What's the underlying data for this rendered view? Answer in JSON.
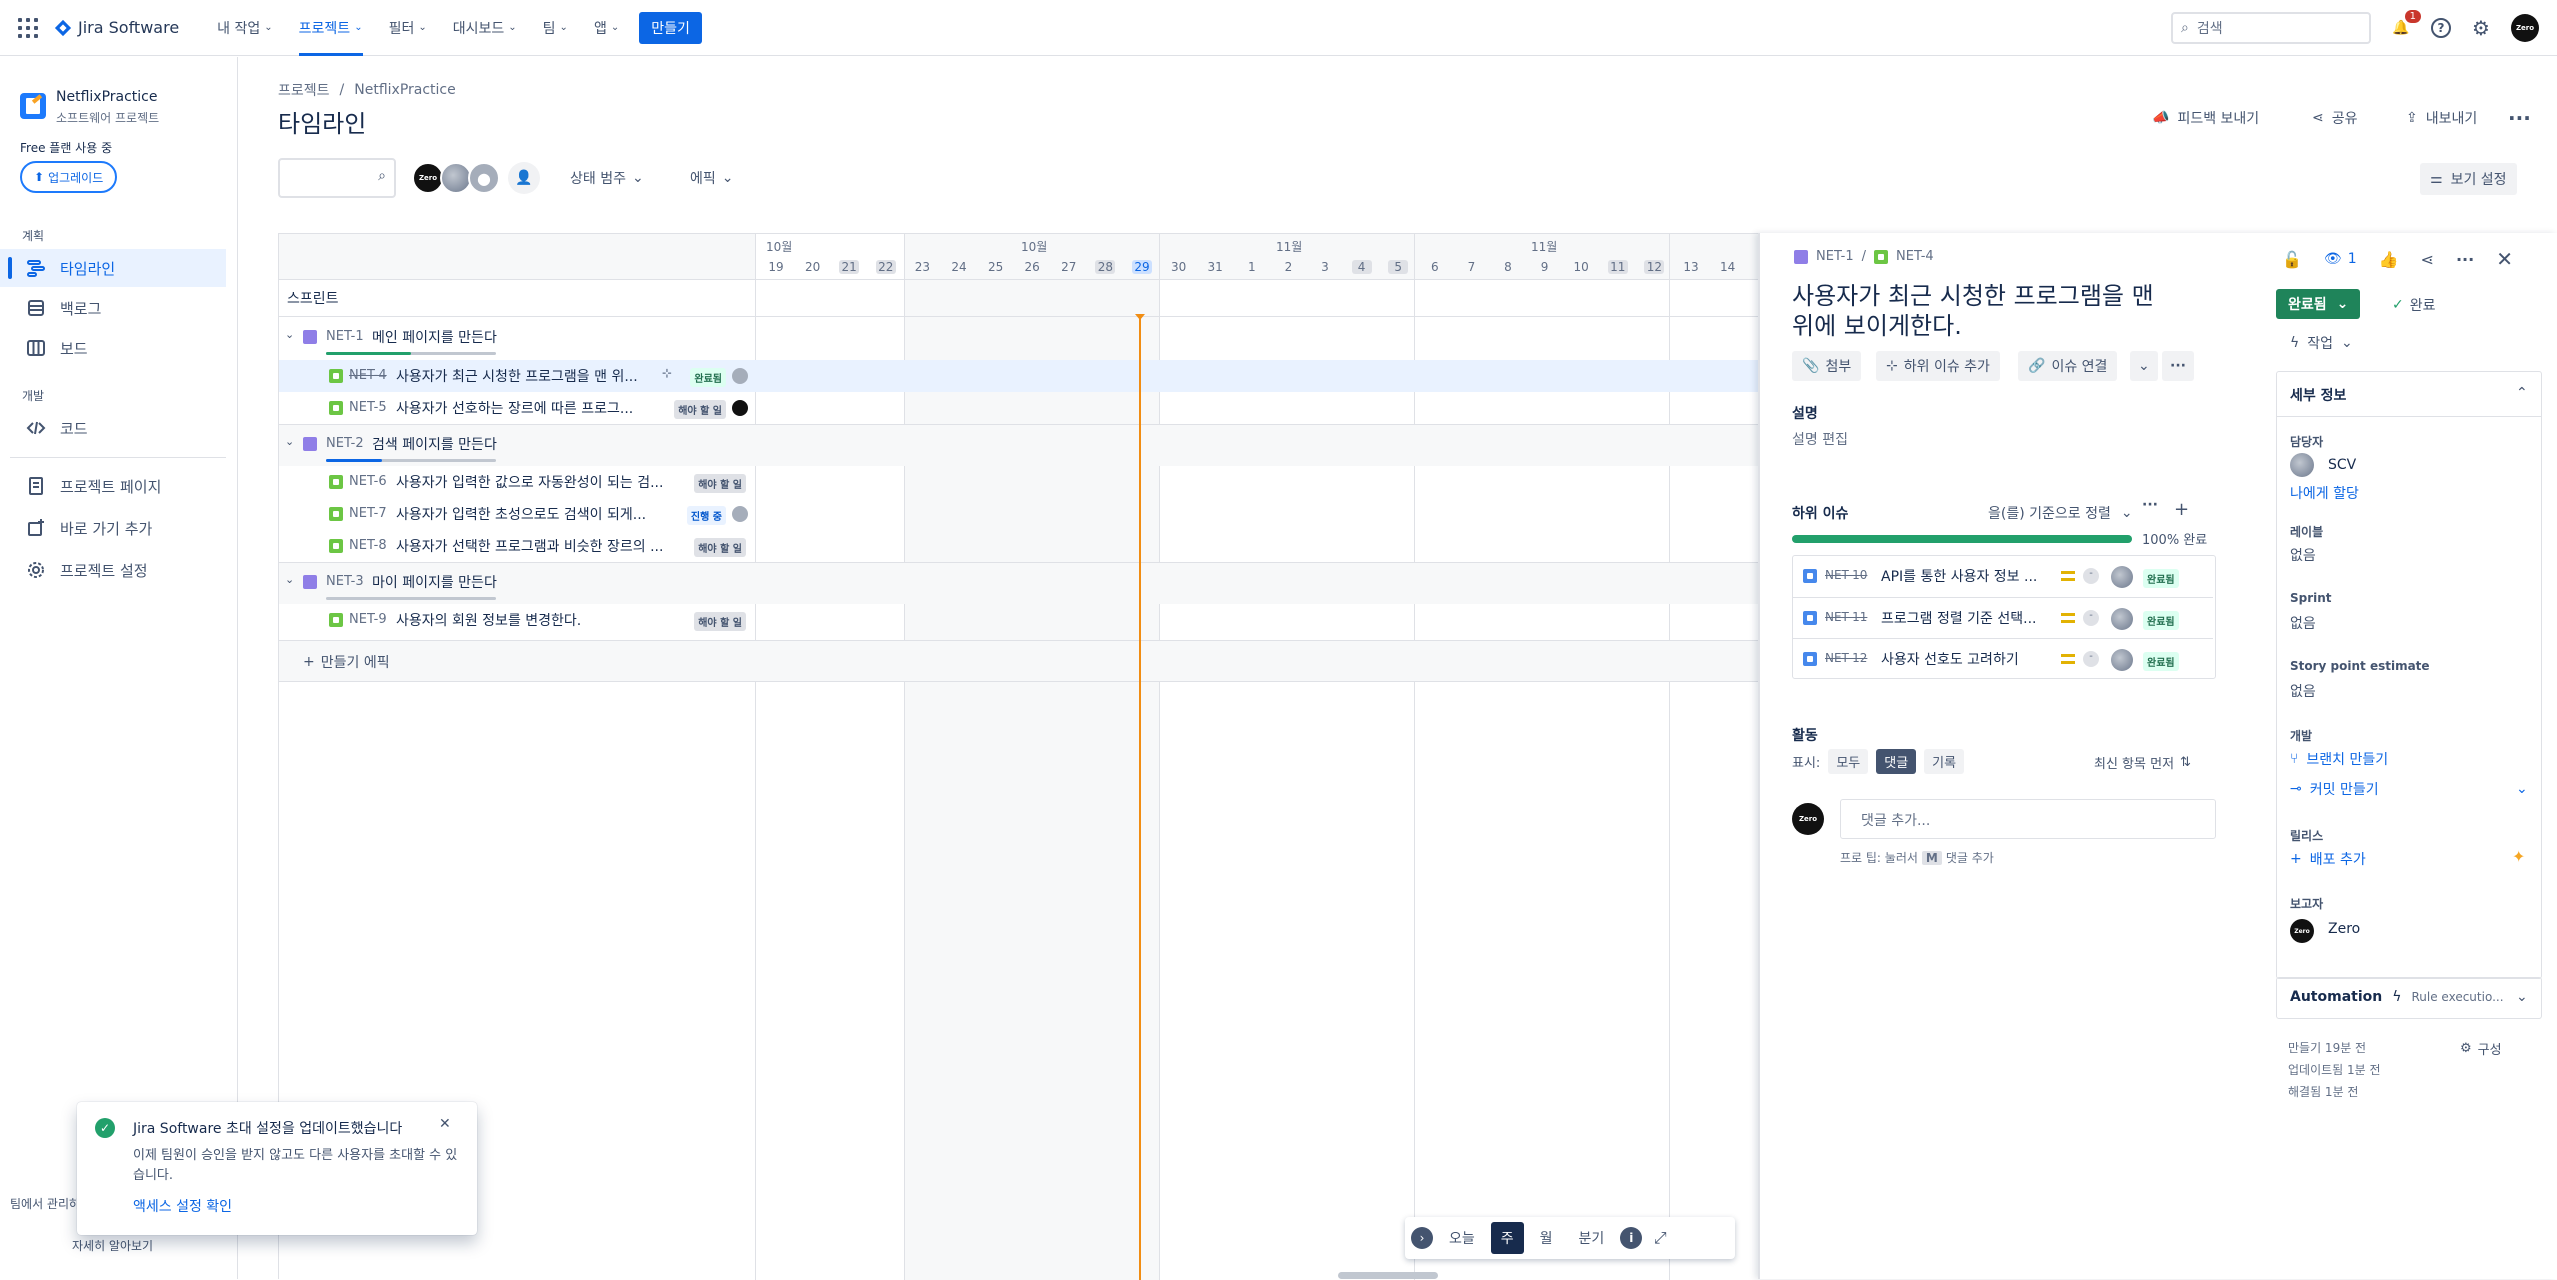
{
  "nav": {
    "product": "Jira Software",
    "items": [
      {
        "label": "내 작업"
      },
      {
        "label": "프로젝트"
      },
      {
        "label": "필터"
      },
      {
        "label": "대시보드"
      },
      {
        "label": "팀"
      },
      {
        "label": "앱"
      }
    ],
    "create": "만들기",
    "search_placeholder": "검색",
    "notif_count": "1",
    "avatar": "Zero"
  },
  "sidebar": {
    "project_name": "NetflixPractice",
    "project_type": "소프트웨어 프로젝트",
    "plan": "Free 플랜 사용 중",
    "upgrade": "업그레이드",
    "section_plan": "계획",
    "section_dev": "개발",
    "items": [
      "타임라인",
      "백로그",
      "보드",
      "코드",
      "프로젝트 페이지",
      "바로 가기 추가",
      "프로젝트 설정"
    ],
    "footer_a": "팀에서 관리하",
    "footer_b": "자세히 알아보기"
  },
  "main": {
    "breadcrumb_a": "프로젝트",
    "breadcrumb_sep": "/",
    "breadcrumb_b": "NetflixPractice",
    "title": "타임라인",
    "feedback": "피드백 보내기",
    "share": "공유",
    "export": "내보내기",
    "status_filter": "상태 범주",
    "epic_filter": "에픽",
    "view_settings": "보기 설정",
    "avatar": "Zero"
  },
  "timeline": {
    "sprint_label": "스프린트",
    "months": [
      "10월",
      "10월",
      "11월",
      "11월"
    ],
    "days": [
      "19",
      "20",
      "21",
      "22",
      "23",
      "24",
      "25",
      "26",
      "27",
      "28",
      "29",
      "30",
      "31",
      "1",
      "2",
      "3",
      "4",
      "5",
      "6",
      "7",
      "8",
      "9",
      "10",
      "11",
      "12",
      "13",
      "14"
    ],
    "rows": [
      {
        "type": "epic",
        "key": "NET-1",
        "summary": "메인 페이지를 만든다",
        "progress": 0.5
      },
      {
        "type": "issue",
        "key": "NET-4",
        "summary": "사용자가 최근 시청한 프로그램을 맨 위...",
        "status": "완료됨",
        "done": true
      },
      {
        "type": "issue",
        "key": "NET-5",
        "summary": "사용자가 선호하는 장르에 따른 프로그...",
        "status": "해야 할 일"
      },
      {
        "type": "epic",
        "key": "NET-2",
        "summary": "검색 페이지를 만든다",
        "progress": 0.33
      },
      {
        "type": "issue",
        "key": "NET-6",
        "summary": "사용자가 입력한 값으로 자동완성이 되는 검...",
        "status": "해야 할 일"
      },
      {
        "type": "issue",
        "key": "NET-7",
        "summary": "사용자가 입력한 초성으로도 검색이 되게...",
        "status": "진행 중"
      },
      {
        "type": "issue",
        "key": "NET-8",
        "summary": "사용자가 선택한 프로그램과 비슷한 장르의 ...",
        "status": "해야 할 일"
      },
      {
        "type": "epic",
        "key": "NET-3",
        "summary": "마이 페이지를 만든다",
        "progress": 0
      },
      {
        "type": "issue",
        "key": "NET-9",
        "summary": "사용자의 회원 정보를 변경한다.",
        "status": "해야 할 일"
      }
    ],
    "create_epic": "만들기 에픽"
  },
  "zoom": {
    "today": "오늘",
    "week": "주",
    "month": "월",
    "quarter": "분기"
  },
  "panel": {
    "parent_key": "NET-1",
    "sep": "/",
    "key": "NET-4",
    "watch_count": "1",
    "title": "사용자가 최근 시청한 프로그램을 맨 위에 보이게한다.",
    "btn_attach": "첨부",
    "btn_child": "하위 이슈 추가",
    "btn_link": "이슈 연결",
    "desc_label": "설명",
    "desc_edit": "설명 편집",
    "sub_label": "하위 이슈",
    "sort": "을(를) 기준으로 정렬",
    "progress_text": "100% 완료",
    "progress": 1.0,
    "subtasks": [
      {
        "key": "NET-10",
        "summary": "API를 통한 사용자 정보 ...",
        "status": "완료됨"
      },
      {
        "key": "NET-11",
        "summary": "프로그램 정렬 기준 선택...",
        "status": "완료됨"
      },
      {
        "key": "NET-12",
        "summary": "사용자 선호도 고려하기",
        "status": "완료됨"
      }
    ],
    "activity": "활동",
    "show": "표시:",
    "tab_all": "모두",
    "tab_comments": "댓글",
    "tab_history": "기록",
    "newest": "최신 항목 먼저",
    "comment_placeholder": "댓글 추가...",
    "tip_a": "프로 팁: 눌러서",
    "tip_key": "M",
    "tip_b": "댓글 추가",
    "status_btn": "완료됨",
    "done_label": "완료",
    "action": "작업",
    "details": "세부 정보",
    "assignee_label": "담당자",
    "assignee": "SCV",
    "assign_me": "나에게 할당",
    "labels_label": "레이블",
    "labels": "없음",
    "sprint_label": "Sprint",
    "sprint": "없음",
    "sp_label": "Story point estimate",
    "sp": "없음",
    "dev_label": "개발",
    "branch": "브랜치 만들기",
    "commit": "커밋 만들기",
    "release_label": "릴리스",
    "release_add": "배포 추가",
    "reporter_label": "보고자",
    "reporter": "Zero",
    "automation": "Automation",
    "rule": "Rule executio...",
    "created": "만들기 19분 전",
    "updated": "업데이트됨 1분 전",
    "resolved": "해결됨 1분 전",
    "configure": "구성"
  },
  "toast": {
    "title": "Jira Software 초대 설정을 업데이트했습니다",
    "body": "이제 팀원이 승인을 받지 않고도 다른 사용자를 초대할 수 있습니다.",
    "link": "액세스 설정 확인"
  }
}
